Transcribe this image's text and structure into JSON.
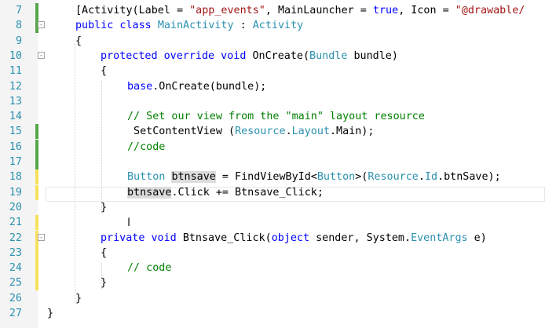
{
  "editor": {
    "lines": [
      {
        "num": "7",
        "change": "saved",
        "fold": "",
        "tokens": [
          {
            "t": "plain",
            "v": "[Activity(Label = "
          },
          {
            "t": "str",
            "v": "\"app_events\""
          },
          {
            "t": "plain",
            "v": ", MainLauncher = "
          },
          {
            "t": "kw",
            "v": "true"
          },
          {
            "t": "plain",
            "v": ", Icon = "
          },
          {
            "t": "str",
            "v": "\"@drawable/"
          }
        ]
      },
      {
        "num": "8",
        "change": "saved",
        "fold": "-",
        "tokens": [
          {
            "t": "kw",
            "v": "public class "
          },
          {
            "t": "ty",
            "v": "MainActivity"
          },
          {
            "t": "plain",
            "v": " : "
          },
          {
            "t": "ty",
            "v": "Activity"
          }
        ]
      },
      {
        "num": "9",
        "change": "",
        "fold": "",
        "tokens": [
          {
            "t": "plain",
            "v": "{"
          }
        ]
      },
      {
        "num": "10",
        "change": "",
        "fold": "-",
        "tokens": [
          {
            "t": "kw",
            "v": "protected override void "
          },
          {
            "t": "plain",
            "v": "OnCreate("
          },
          {
            "t": "ty",
            "v": "Bundle"
          },
          {
            "t": "plain",
            "v": " bundle)"
          }
        ]
      },
      {
        "num": "11",
        "change": "",
        "fold": "",
        "tokens": [
          {
            "t": "plain",
            "v": "{"
          }
        ]
      },
      {
        "num": "12",
        "change": "",
        "fold": "",
        "tokens": [
          {
            "t": "kw",
            "v": "base"
          },
          {
            "t": "plain",
            "v": ".OnCreate(bundle);"
          }
        ]
      },
      {
        "num": "13",
        "change": "",
        "fold": "",
        "tokens": []
      },
      {
        "num": "14",
        "change": "",
        "fold": "",
        "tokens": [
          {
            "t": "cm",
            "v": "// Set our view from the \"main\" layout resource"
          }
        ]
      },
      {
        "num": "15",
        "change": "saved",
        "fold": "",
        "tokens": [
          {
            "t": "plain",
            "v": " SetContentView ("
          },
          {
            "t": "ty",
            "v": "Resource"
          },
          {
            "t": "plain",
            "v": "."
          },
          {
            "t": "ty",
            "v": "Layout"
          },
          {
            "t": "plain",
            "v": ".Main);"
          }
        ]
      },
      {
        "num": "16",
        "change": "saved",
        "fold": "",
        "tokens": [
          {
            "t": "cm",
            "v": "//code"
          }
        ]
      },
      {
        "num": "17",
        "change": "saved",
        "fold": "",
        "tokens": []
      },
      {
        "num": "18",
        "change": "unsaved",
        "fold": "",
        "tokens": [
          {
            "t": "ty",
            "v": "Button"
          },
          {
            "t": "plain",
            "v": " "
          },
          {
            "t": "hl",
            "v": "btnsave"
          },
          {
            "t": "plain",
            "v": " = FindViewById<"
          },
          {
            "t": "ty",
            "v": "Button"
          },
          {
            "t": "plain",
            "v": ">("
          },
          {
            "t": "ty",
            "v": "Resource"
          },
          {
            "t": "plain",
            "v": "."
          },
          {
            "t": "ty",
            "v": "Id"
          },
          {
            "t": "plain",
            "v": ".btnSave);"
          }
        ]
      },
      {
        "num": "19",
        "change": "unsaved",
        "fold": "",
        "tokens": [
          {
            "t": "hl",
            "v": "btnsave"
          },
          {
            "t": "plain",
            "v": ".Click += Btnsave_Click;"
          }
        ]
      },
      {
        "num": "20",
        "change": "",
        "fold": "",
        "tokens": [
          {
            "t": "plain",
            "v": "}"
          }
        ]
      },
      {
        "num": "21",
        "change": "unsaved",
        "fold": "",
        "tokens": []
      },
      {
        "num": "22",
        "change": "unsaved",
        "fold": "-",
        "tokens": [
          {
            "t": "kw",
            "v": "private void "
          },
          {
            "t": "plain",
            "v": "Btnsave_Click("
          },
          {
            "t": "kw",
            "v": "object"
          },
          {
            "t": "plain",
            "v": " sender, System."
          },
          {
            "t": "ty",
            "v": "EventArgs"
          },
          {
            "t": "plain",
            "v": " e)"
          }
        ]
      },
      {
        "num": "23",
        "change": "unsaved",
        "fold": "",
        "tokens": [
          {
            "t": "plain",
            "v": "{"
          }
        ]
      },
      {
        "num": "24",
        "change": "unsaved",
        "fold": "",
        "tokens": [
          {
            "t": "cm",
            "v": "// code"
          }
        ]
      },
      {
        "num": "25",
        "change": "unsaved",
        "fold": "",
        "tokens": [
          {
            "t": "plain",
            "v": "}"
          }
        ]
      },
      {
        "num": "26",
        "change": "",
        "fold": "",
        "tokens": [
          {
            "t": "plain",
            "v": "}"
          }
        ]
      },
      {
        "num": "27",
        "change": "",
        "fold": "",
        "tokens": [
          {
            "t": "plain",
            "v": "}"
          }
        ]
      }
    ]
  },
  "colors": {
    "keyword": "#0000ff",
    "type": "#2b91af",
    "string": "#a31515",
    "comment": "#008000",
    "line_number": "#2b91af",
    "change_saved": "#57a64a",
    "change_unsaved": "#f6e15a"
  }
}
